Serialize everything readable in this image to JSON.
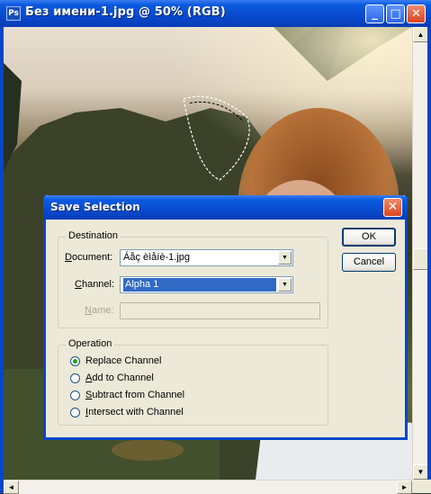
{
  "window": {
    "title": "Без имени-1.jpg @ 50% (RGB)",
    "minimize": "_",
    "maximize": "□",
    "close": "✕"
  },
  "dialog": {
    "title": "Save Selection",
    "close": "✕",
    "ok_label": "OK",
    "cancel_label": "Cancel",
    "destination": {
      "legend": "Destination",
      "document_label_u": "D",
      "document_label_rest": "ocument:",
      "document_value": "Áåç èìåíè-1.jpg",
      "channel_label_u": "C",
      "channel_label_rest": "hannel:",
      "channel_value": "Alpha 1",
      "name_label_u": "N",
      "name_label_rest": "ame:",
      "name_value": ""
    },
    "operation": {
      "legend": "Operation",
      "options": [
        {
          "u": "",
          "rest": "Replace Channel",
          "selected": true
        },
        {
          "u": "A",
          "rest": "dd to Channel",
          "selected": false
        },
        {
          "u": "S",
          "rest": "ubtract from Channel",
          "selected": false
        },
        {
          "u": "I",
          "rest": "ntersect with Channel",
          "selected": false
        }
      ]
    }
  },
  "scroll": {
    "up": "▲",
    "down": "▼",
    "left": "◄",
    "right": "►"
  },
  "colors": {
    "titlebar": "#0846c8",
    "dialog_bg": "#ece9d8",
    "selection": "#316ac5"
  }
}
